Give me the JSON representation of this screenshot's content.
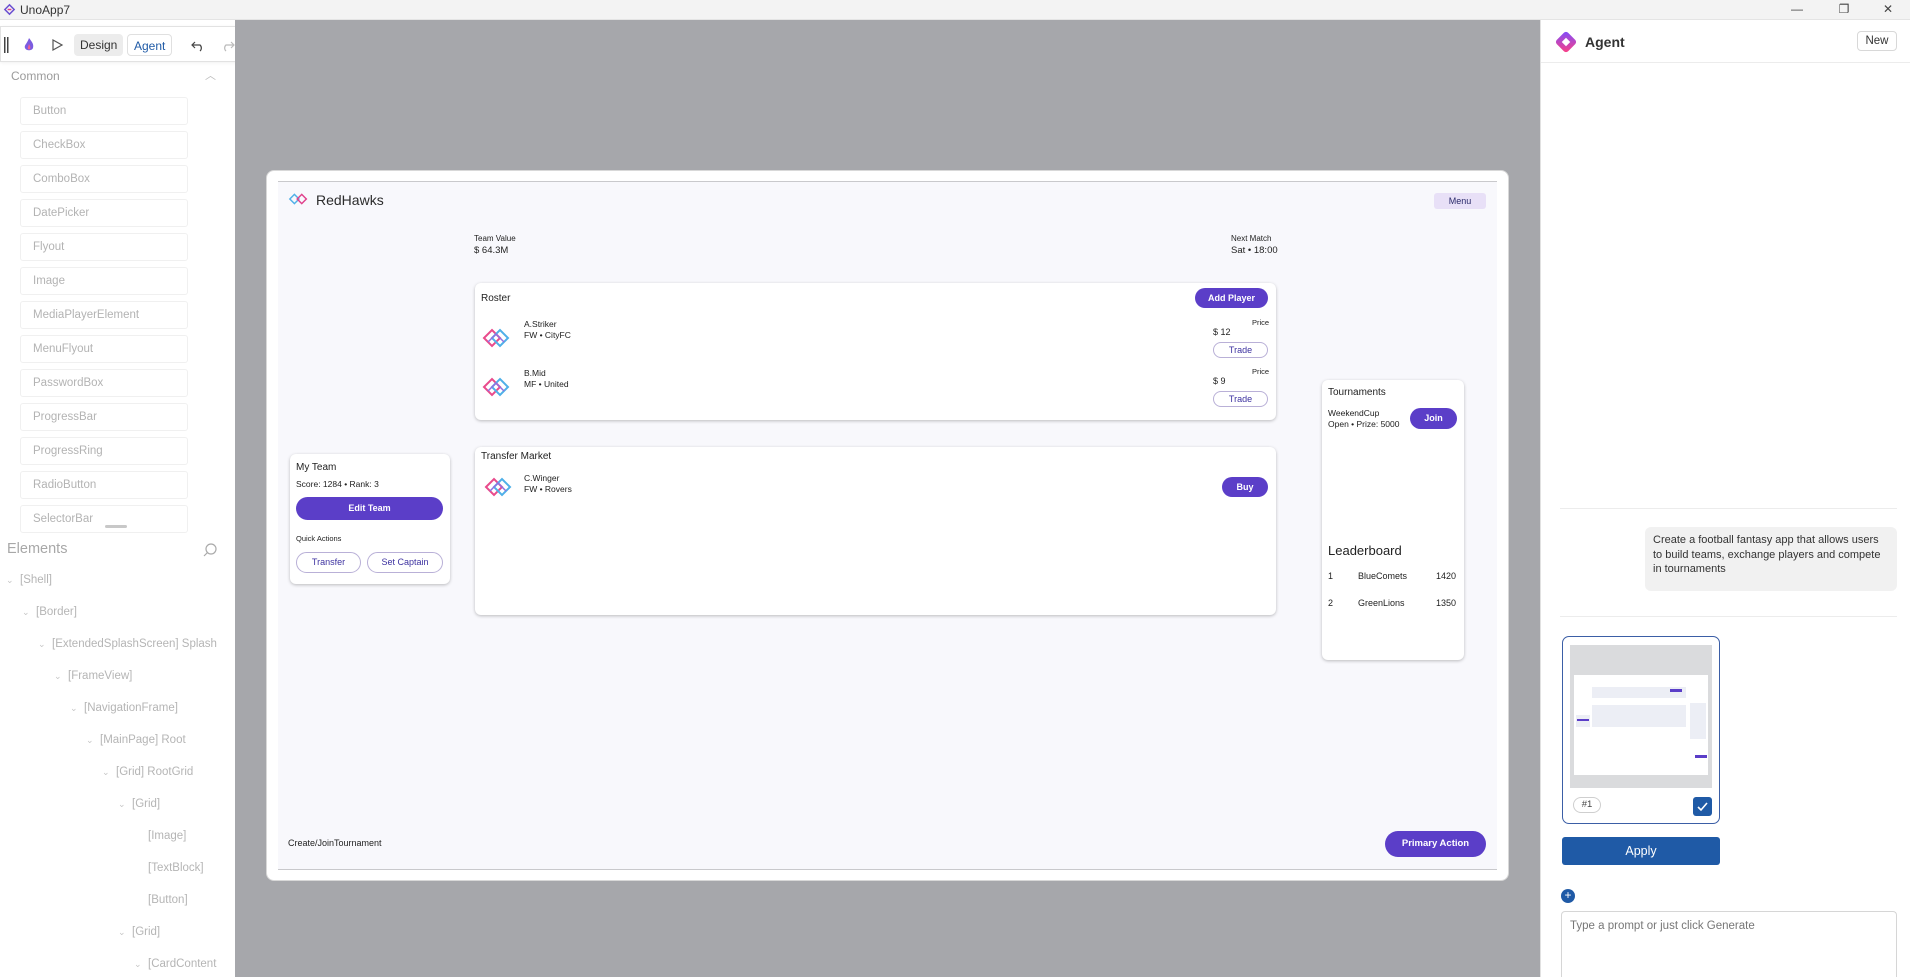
{
  "window": {
    "title": "UnoApp7",
    "minimize": "—",
    "maximize": "❐",
    "close": "✕"
  },
  "toolbar": {
    "design_label": "Design",
    "agent_label": "Agent"
  },
  "controls": {
    "header": "Common",
    "items": [
      "Button",
      "CheckBox",
      "ComboBox",
      "DatePicker",
      "Flyout",
      "Image",
      "MediaPlayerElement",
      "MenuFlyout",
      "PasswordBox",
      "ProgressBar",
      "ProgressRing",
      "RadioButton",
      "SelectorBar"
    ]
  },
  "elements": {
    "header": "Elements",
    "tree": [
      {
        "label": "[Shell]",
        "depth": 0,
        "expander": "⌄"
      },
      {
        "label": "[Border]",
        "depth": 1,
        "expander": "⌄"
      },
      {
        "label": "[ExtendedSplashScreen] Splash",
        "depth": 2,
        "expander": "⌄"
      },
      {
        "label": "[FrameView]",
        "depth": 3,
        "expander": "⌄"
      },
      {
        "label": "[NavigationFrame]",
        "depth": 4,
        "expander": "⌄"
      },
      {
        "label": "[MainPage] Root",
        "depth": 5,
        "expander": "⌄"
      },
      {
        "label": "[Grid] RootGrid",
        "depth": 6,
        "expander": "⌄"
      },
      {
        "label": "[Grid]",
        "depth": 7,
        "expander": "⌄"
      },
      {
        "label": "[Image]",
        "depth": 8,
        "expander": ""
      },
      {
        "label": "[TextBlock]",
        "depth": 8,
        "expander": ""
      },
      {
        "label": "[Button]",
        "depth": 8,
        "expander": ""
      },
      {
        "label": "[Grid]",
        "depth": 7,
        "expander": "⌄"
      },
      {
        "label": "[CardContent",
        "depth": 8,
        "expander": "⌄"
      }
    ]
  },
  "app": {
    "brand": "RedHawks",
    "menu": "Menu",
    "team_value_label": "Team Value",
    "team_value": "$  64.3M",
    "next_match_label": "Next Match",
    "next_match": "Sat • 18:00",
    "my_team": {
      "title": "My Team",
      "score_line": "Score:  1284   • Rank:  3",
      "edit_button": "Edit Team",
      "quick_actions": "Quick Actions",
      "transfer_button": "Transfer",
      "captain_button": "Set Captain"
    },
    "roster": {
      "title": "Roster",
      "add_button": "Add Player",
      "players": [
        {
          "name": "A.Striker",
          "meta": "FW  •  CityFC",
          "price_label": "Price",
          "price": "$ 12",
          "action": "Trade"
        },
        {
          "name": "B.Mid",
          "meta": "MF  •  United",
          "price_label": "Price",
          "price": "$ 9",
          "action": "Trade"
        }
      ]
    },
    "market": {
      "title": "Transfer Market",
      "players": [
        {
          "name": "C.Winger",
          "meta": "FW  •  Rovers",
          "action": "Buy"
        }
      ]
    },
    "tournaments": {
      "title": "Tournaments",
      "name": "WeekendCup",
      "detail": "Open  • Prize:  5000",
      "join_button": "Join"
    },
    "leaderboard": {
      "title": "Leaderboard",
      "rows": [
        {
          "rank": "1",
          "team": "BlueComets",
          "points": "1420"
        },
        {
          "rank": "2",
          "team": "GreenLions",
          "points": "1350"
        }
      ]
    },
    "footer_text": "Create/JoinTournament",
    "primary_button": "Primary Action"
  },
  "agent": {
    "title": "Agent",
    "new_button": "New",
    "message": "Create a football fantasy app that allows users to build teams, exchange players and compete in tournaments",
    "thumbnail_label": "#1",
    "apply_button": "Apply",
    "add_button": "+",
    "prompt_placeholder": "Type a prompt or just click Generate"
  },
  "colors": {
    "accent": "#5b3ec8",
    "agent_blue": "#1f5aa6",
    "canvas": "#a6a7ab"
  }
}
